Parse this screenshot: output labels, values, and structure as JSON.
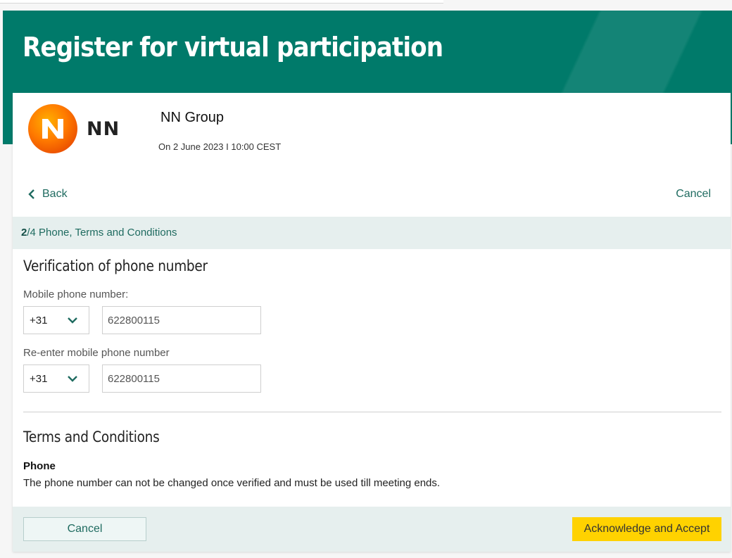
{
  "header": {
    "title": "Register for virtual participation"
  },
  "company": {
    "logo_text": "NN",
    "name": "NN Group",
    "event_date": "On 2 June 2023 I 10:00 CEST",
    "brand_color": "#ff6200"
  },
  "nav": {
    "back_label": "Back",
    "cancel_label": "Cancel"
  },
  "progress": {
    "current": "2",
    "rest": "/4 Phone, Terms and Conditions"
  },
  "verification": {
    "title": "Verification of phone number",
    "mobile_label": "Mobile phone number:",
    "mobile_country_code": "+31",
    "mobile_number": "622800115",
    "reenter_label": "Re-enter mobile phone number",
    "reenter_country_code": "+31",
    "reenter_number": "622800115"
  },
  "terms": {
    "title": "Terms and Conditions",
    "subheading": "Phone",
    "text": "The phone number can not be changed once verified and must be used till meeting ends."
  },
  "footer": {
    "cancel_label": "Cancel",
    "accept_label": "Acknowledge and Accept"
  },
  "colors": {
    "header_green": "#007a6a",
    "accent_teal": "#1f6b60",
    "accept_yellow": "#ffd200"
  }
}
